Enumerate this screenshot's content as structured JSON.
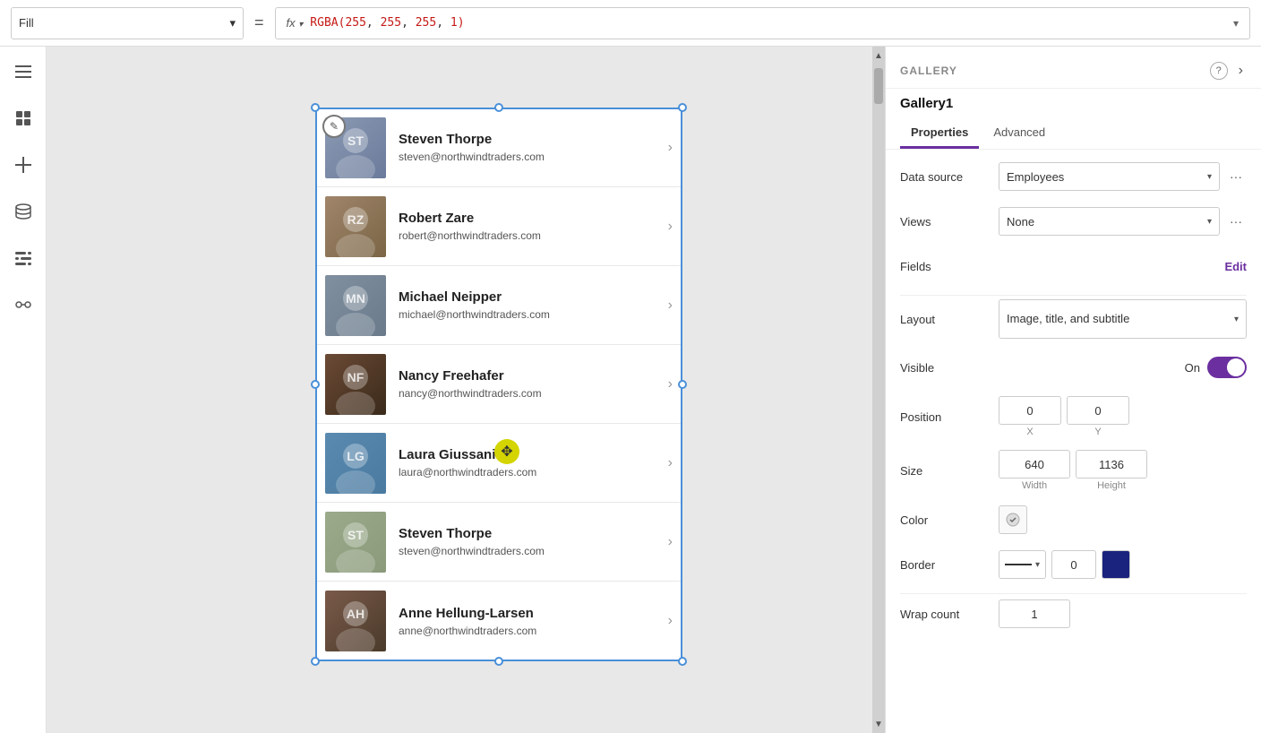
{
  "topbar": {
    "fill_label": "Fill",
    "equals": "=",
    "fx_label": "fx",
    "formula_value": "RGBA(255, 255, 255, 1)",
    "expand_label": "▾"
  },
  "left_sidebar": {
    "icons": [
      {
        "name": "menu-icon",
        "symbol": "≡"
      },
      {
        "name": "layers-icon",
        "symbol": "⊞"
      },
      {
        "name": "insert-icon",
        "symbol": "+"
      },
      {
        "name": "data-icon",
        "symbol": "🗄"
      },
      {
        "name": "controls-icon",
        "symbol": "⊟"
      },
      {
        "name": "tools-icon",
        "symbol": "✂"
      }
    ]
  },
  "gallery": {
    "title": "Gallery1",
    "items": [
      {
        "name": "Steven Thorpe",
        "email": "steven@northwindtraders.com",
        "avatar_color1": "#8B9BB4",
        "avatar_color2": "#6a7a9a"
      },
      {
        "name": "Robert Zare",
        "email": "robert@northwindtraders.com",
        "avatar_color1": "#A0856B",
        "avatar_color2": "#7a6545"
      },
      {
        "name": "Michael Neipper",
        "email": "michael@northwindtraders.com",
        "avatar_color1": "#8090A0",
        "avatar_color2": "#6a7a8a"
      },
      {
        "name": "Nancy Freehafer",
        "email": "nancy@northwindtraders.com",
        "avatar_color1": "#6B4A35",
        "avatar_color2": "#3a2a1a"
      },
      {
        "name": "Laura Giussani",
        "email": "laura@northwindtraders.com",
        "avatar_color1": "#5a8ab0",
        "avatar_color2": "#4a7aa0"
      },
      {
        "name": "Steven Thorpe",
        "email": "steven@northwindtraders.com",
        "avatar_color1": "#9aaa8a",
        "avatar_color2": "#8a9a7a"
      },
      {
        "name": "Anne Hellung-Larsen",
        "email": "anne@northwindtraders.com",
        "avatar_color1": "#7a5a4a",
        "avatar_color2": "#4a3a2a"
      }
    ]
  },
  "right_panel": {
    "section_title": "GALLERY",
    "help_label": "?",
    "gallery_name": "Gallery1",
    "tabs": [
      {
        "id": "properties",
        "label": "Properties",
        "active": true
      },
      {
        "id": "advanced",
        "label": "Advanced",
        "active": false
      }
    ],
    "data_source_label": "Data source",
    "data_source_value": "Employees",
    "views_label": "Views",
    "views_value": "None",
    "fields_label": "Fields",
    "fields_edit": "Edit",
    "layout_label": "Layout",
    "layout_value": "Image, title, and subtitle",
    "visible_label": "Visible",
    "visible_toggle_label": "On",
    "position_label": "Position",
    "position_x": "0",
    "position_y": "0",
    "position_x_label": "X",
    "position_y_label": "Y",
    "size_label": "Size",
    "size_width": "640",
    "size_height": "1136",
    "size_width_label": "Width",
    "size_height_label": "Height",
    "color_label": "Color",
    "border_label": "Border",
    "border_width": "0",
    "wrap_count_label": "Wrap count",
    "wrap_count_value": "1",
    "expand_icon": "›"
  }
}
